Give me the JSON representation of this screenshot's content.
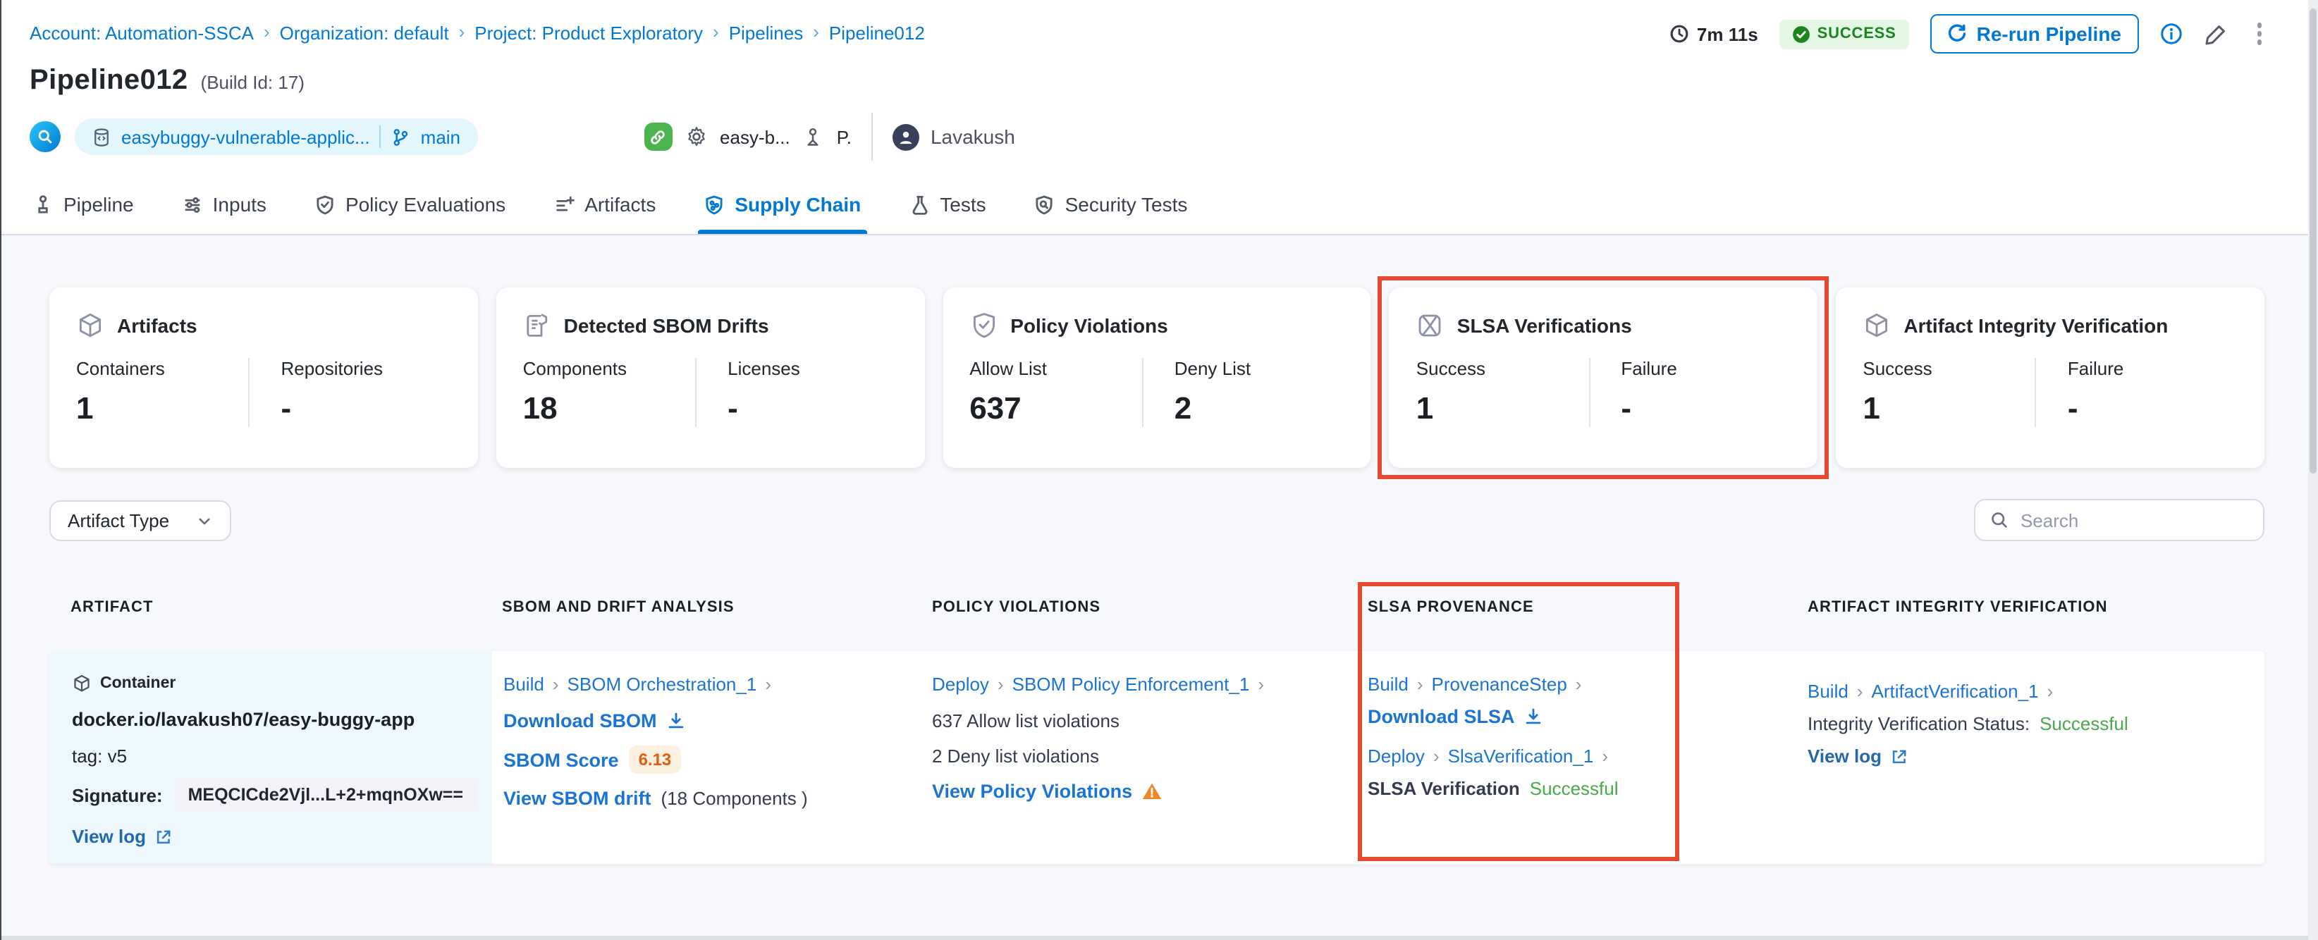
{
  "breadcrumb": {
    "items": [
      "Account: Automation-SSCA",
      "Organization: default",
      "Project: Product Exploratory",
      "Pipelines",
      "Pipeline012"
    ]
  },
  "topbar": {
    "duration": "7m 11s",
    "status": "SUCCESS",
    "rerun": "Re-run Pipeline"
  },
  "header": {
    "title": "Pipeline012",
    "build_id": "(Build Id: 17)",
    "repo_name": "easybuggy-vulnerable-applic...",
    "branch": "main",
    "trigger_name": "easy-b...",
    "delegate_initial": "P.",
    "user_name": "Lavakush"
  },
  "tabs": [
    {
      "label": "Pipeline"
    },
    {
      "label": "Inputs"
    },
    {
      "label": "Policy Evaluations"
    },
    {
      "label": "Artifacts"
    },
    {
      "label": "Supply Chain"
    },
    {
      "label": "Tests"
    },
    {
      "label": "Security Tests"
    }
  ],
  "cards": [
    {
      "title": "Artifacts",
      "metrics": [
        {
          "label": "Containers",
          "value": "1"
        },
        {
          "label": "Repositories",
          "value": "-"
        }
      ]
    },
    {
      "title": "Detected SBOM Drifts",
      "metrics": [
        {
          "label": "Components",
          "value": "18"
        },
        {
          "label": "Licenses",
          "value": "-"
        }
      ]
    },
    {
      "title": "Policy Violations",
      "metrics": [
        {
          "label": "Allow List",
          "value": "637"
        },
        {
          "label": "Deny List",
          "value": "2"
        }
      ]
    },
    {
      "title": "SLSA Verifications",
      "metrics": [
        {
          "label": "Success",
          "value": "1"
        },
        {
          "label": "Failure",
          "value": "-"
        }
      ]
    },
    {
      "title": "Artifact Integrity Verification",
      "metrics": [
        {
          "label": "Success",
          "value": "1"
        },
        {
          "label": "Failure",
          "value": "-"
        }
      ]
    }
  ],
  "filters": {
    "artifact_type": "Artifact Type",
    "search_placeholder": "Search"
  },
  "table": {
    "headers": [
      "ARTIFACT",
      "SBOM AND DRIFT ANALYSIS",
      "POLICY VIOLATIONS",
      "SLSA PROVENANCE",
      "ARTIFACT INTEGRITY VERIFICATION"
    ],
    "row": {
      "artifact": {
        "type": "Container",
        "name": "docker.io/lavakush07/easy-buggy-app",
        "tag": "tag: v5",
        "signature_label": "Signature:",
        "signature": "MEQCICde2Vjl...L+2+mqnOXw==",
        "view_log": "View log"
      },
      "sbom": {
        "stage": "Build",
        "step": "SBOM Orchestration_1",
        "download": "Download SBOM",
        "score_label": "SBOM Score",
        "score": "6.13",
        "drift": "View SBOM drift",
        "components": "(18 Components )"
      },
      "policy": {
        "stage": "Deploy",
        "step": "SBOM Policy Enforcement_1",
        "allow": "637 Allow list violations",
        "deny": "2 Deny list violations",
        "view": "View Policy Violations"
      },
      "slsa": {
        "stage1": "Build",
        "step1": "ProvenanceStep",
        "download": "Download SLSA",
        "stage2": "Deploy",
        "step2": "SlsaVerification_1",
        "status_label": "SLSA Verification",
        "status": "Successful"
      },
      "integrity": {
        "stage": "Build",
        "step": "ArtifactVerification_1",
        "status_label": "Integrity Verification Status:",
        "status": "Successful",
        "view_log": "View log"
      }
    }
  },
  "colors": {
    "accent": "#0278d5",
    "success_text": "#4aa74e",
    "badge_green": "#1b841d",
    "highlight_red": "#e5492f",
    "warning_orange": "#ee8625",
    "score_orange": "#e05e11"
  }
}
